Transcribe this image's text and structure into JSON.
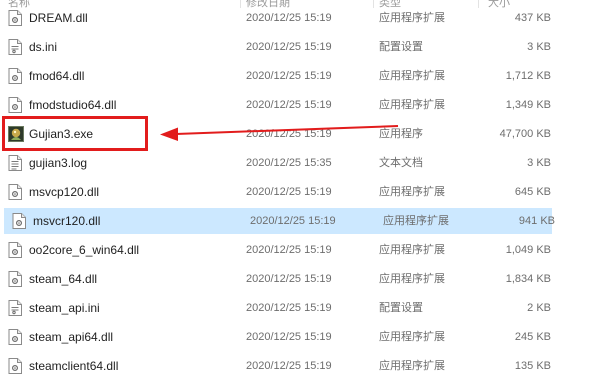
{
  "columns": {
    "name": "名称",
    "date": "修改日期",
    "type": "类型",
    "size": "大小"
  },
  "files": [
    {
      "name": "DREAM.dll",
      "date": "2020/12/25 15:19",
      "type": "应用程序扩展",
      "size": "437 KB",
      "icon": "dll-file-icon"
    },
    {
      "name": "ds.ini",
      "date": "2020/12/25 15:19",
      "type": "配置设置",
      "size": "3 KB",
      "icon": "ini-file-icon"
    },
    {
      "name": "fmod64.dll",
      "date": "2020/12/25 15:19",
      "type": "应用程序扩展",
      "size": "1,712 KB",
      "icon": "dll-file-icon"
    },
    {
      "name": "fmodstudio64.dll",
      "date": "2020/12/25 15:19",
      "type": "应用程序扩展",
      "size": "1,349 KB",
      "icon": "dll-file-icon"
    },
    {
      "name": "Gujian3.exe",
      "date": "2020/12/25 15:19",
      "type": "应用程序",
      "size": "47,700 KB",
      "icon": "gujian-exe-icon"
    },
    {
      "name": "gujian3.log",
      "date": "2020/12/25 15:35",
      "type": "文本文档",
      "size": "3 KB",
      "icon": "log-file-icon"
    },
    {
      "name": "msvcp120.dll",
      "date": "2020/12/25 15:19",
      "type": "应用程序扩展",
      "size": "645 KB",
      "icon": "dll-file-icon"
    },
    {
      "name": "msvcr120.dll",
      "date": "2020/12/25 15:19",
      "type": "应用程序扩展",
      "size": "941 KB",
      "icon": "dll-file-icon"
    },
    {
      "name": "oo2core_6_win64.dll",
      "date": "2020/12/25 15:19",
      "type": "应用程序扩展",
      "size": "1,049 KB",
      "icon": "dll-file-icon"
    },
    {
      "name": "steam_64.dll",
      "date": "2020/12/25 15:19",
      "type": "应用程序扩展",
      "size": "1,834 KB",
      "icon": "dll-file-icon"
    },
    {
      "name": "steam_api.ini",
      "date": "2020/12/25 15:19",
      "type": "配置设置",
      "size": "2 KB",
      "icon": "ini-file-icon"
    },
    {
      "name": "steam_api64.dll",
      "date": "2020/12/25 15:19",
      "type": "应用程序扩展",
      "size": "245 KB",
      "icon": "dll-file-icon"
    },
    {
      "name": "steamclient64.dll",
      "date": "2020/12/25 15:19",
      "type": "应用程序扩展",
      "size": "135 KB",
      "icon": "dll-file-icon"
    }
  ],
  "highlight": {
    "color": "#e21c1c"
  },
  "colors": {
    "selected_row": "#cce8ff",
    "hover_row": "#e5f3ff"
  }
}
